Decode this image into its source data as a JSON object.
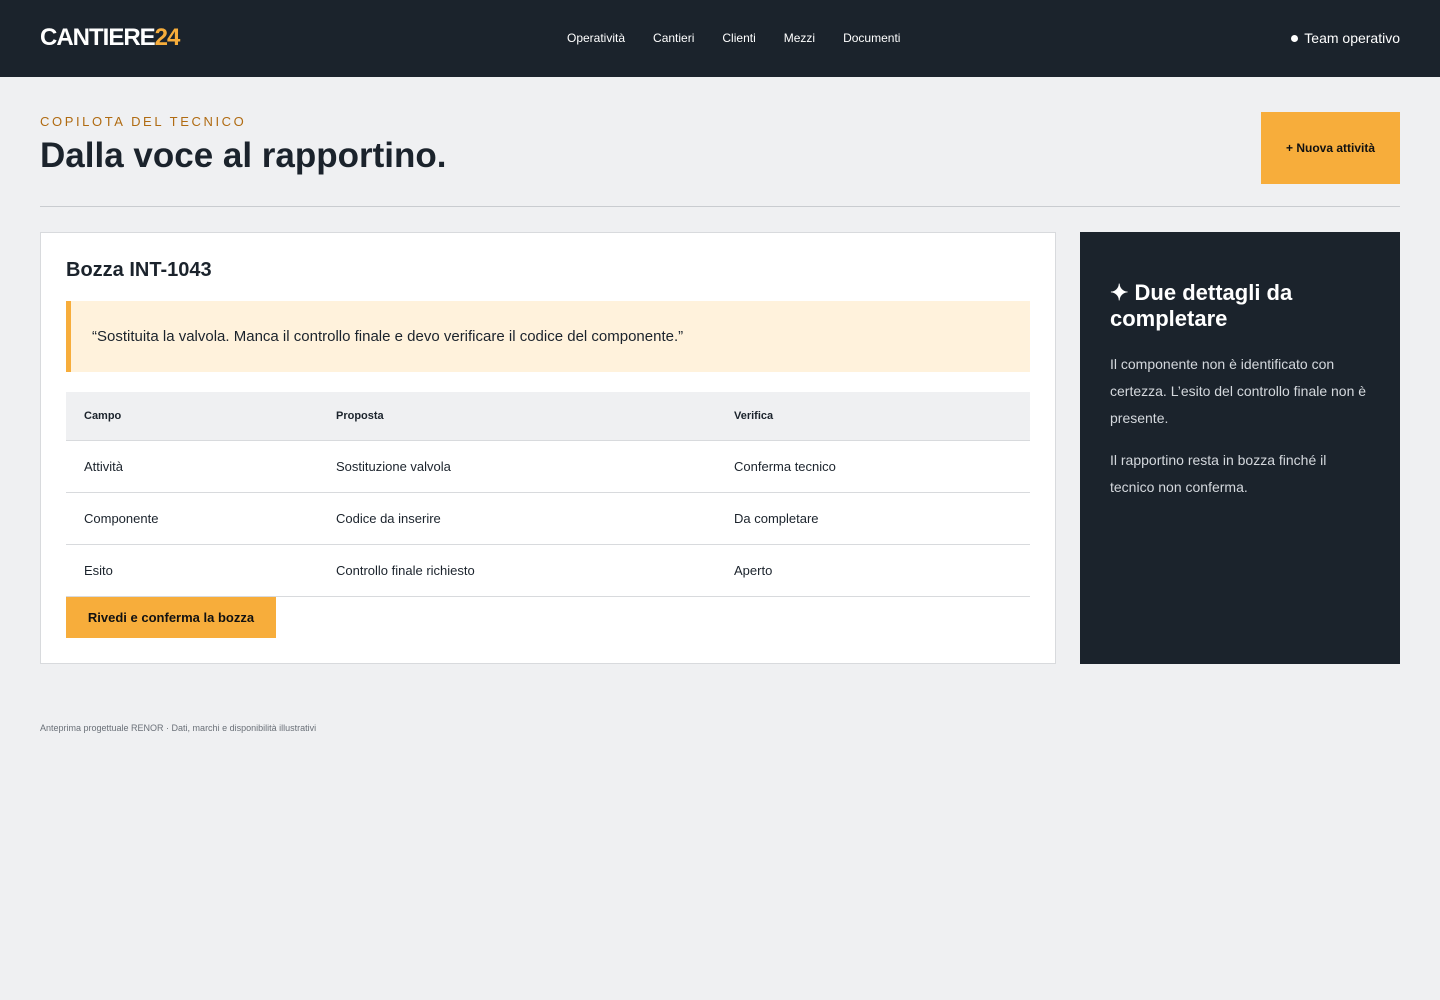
{
  "header": {
    "logo_main": "CANTIERE",
    "logo_accent": "24",
    "nav": [
      "Operatività",
      "Cantieri",
      "Clienti",
      "Mezzi",
      "Documenti"
    ],
    "team_label": "Team operativo"
  },
  "hero": {
    "eyebrow": "COPILOTA DEL TECNICO",
    "title": "Dalla voce al rapportino.",
    "new_button": "+ Nuova attività"
  },
  "draft": {
    "title": "Bozza INT-1043",
    "quote": "“Sostituita la valvola. Manca il controllo finale e devo verificare il codice del componente.”",
    "columns": [
      "Campo",
      "Proposta",
      "Verifica"
    ],
    "rows": [
      [
        "Attività",
        "Sostituzione valvola",
        "Conferma tecnico"
      ],
      [
        "Componente",
        "Codice da inserire",
        "Da completare"
      ],
      [
        "Esito",
        "Controllo finale richiesto",
        "Aperto"
      ]
    ],
    "confirm_button": "Rivedi e conferma la bozza"
  },
  "sidebar": {
    "icon": "sparkle-icon",
    "title": "✦ Due dettagli da completare",
    "paragraph1": "Il componente non è identificato con certezza. L’esito del controllo finale non è presente.",
    "paragraph2": "Il rapportino resta in bozza finché il tecnico non conferma."
  },
  "footer": {
    "note": "Anteprima progettuale RENOR · Dati, marchi e disponibilità illustrativi"
  },
  "colors": {
    "dark": "#1b232c",
    "accent": "#f7ad3b",
    "background": "#eff0f2",
    "quote_bg": "#fff2dc"
  }
}
